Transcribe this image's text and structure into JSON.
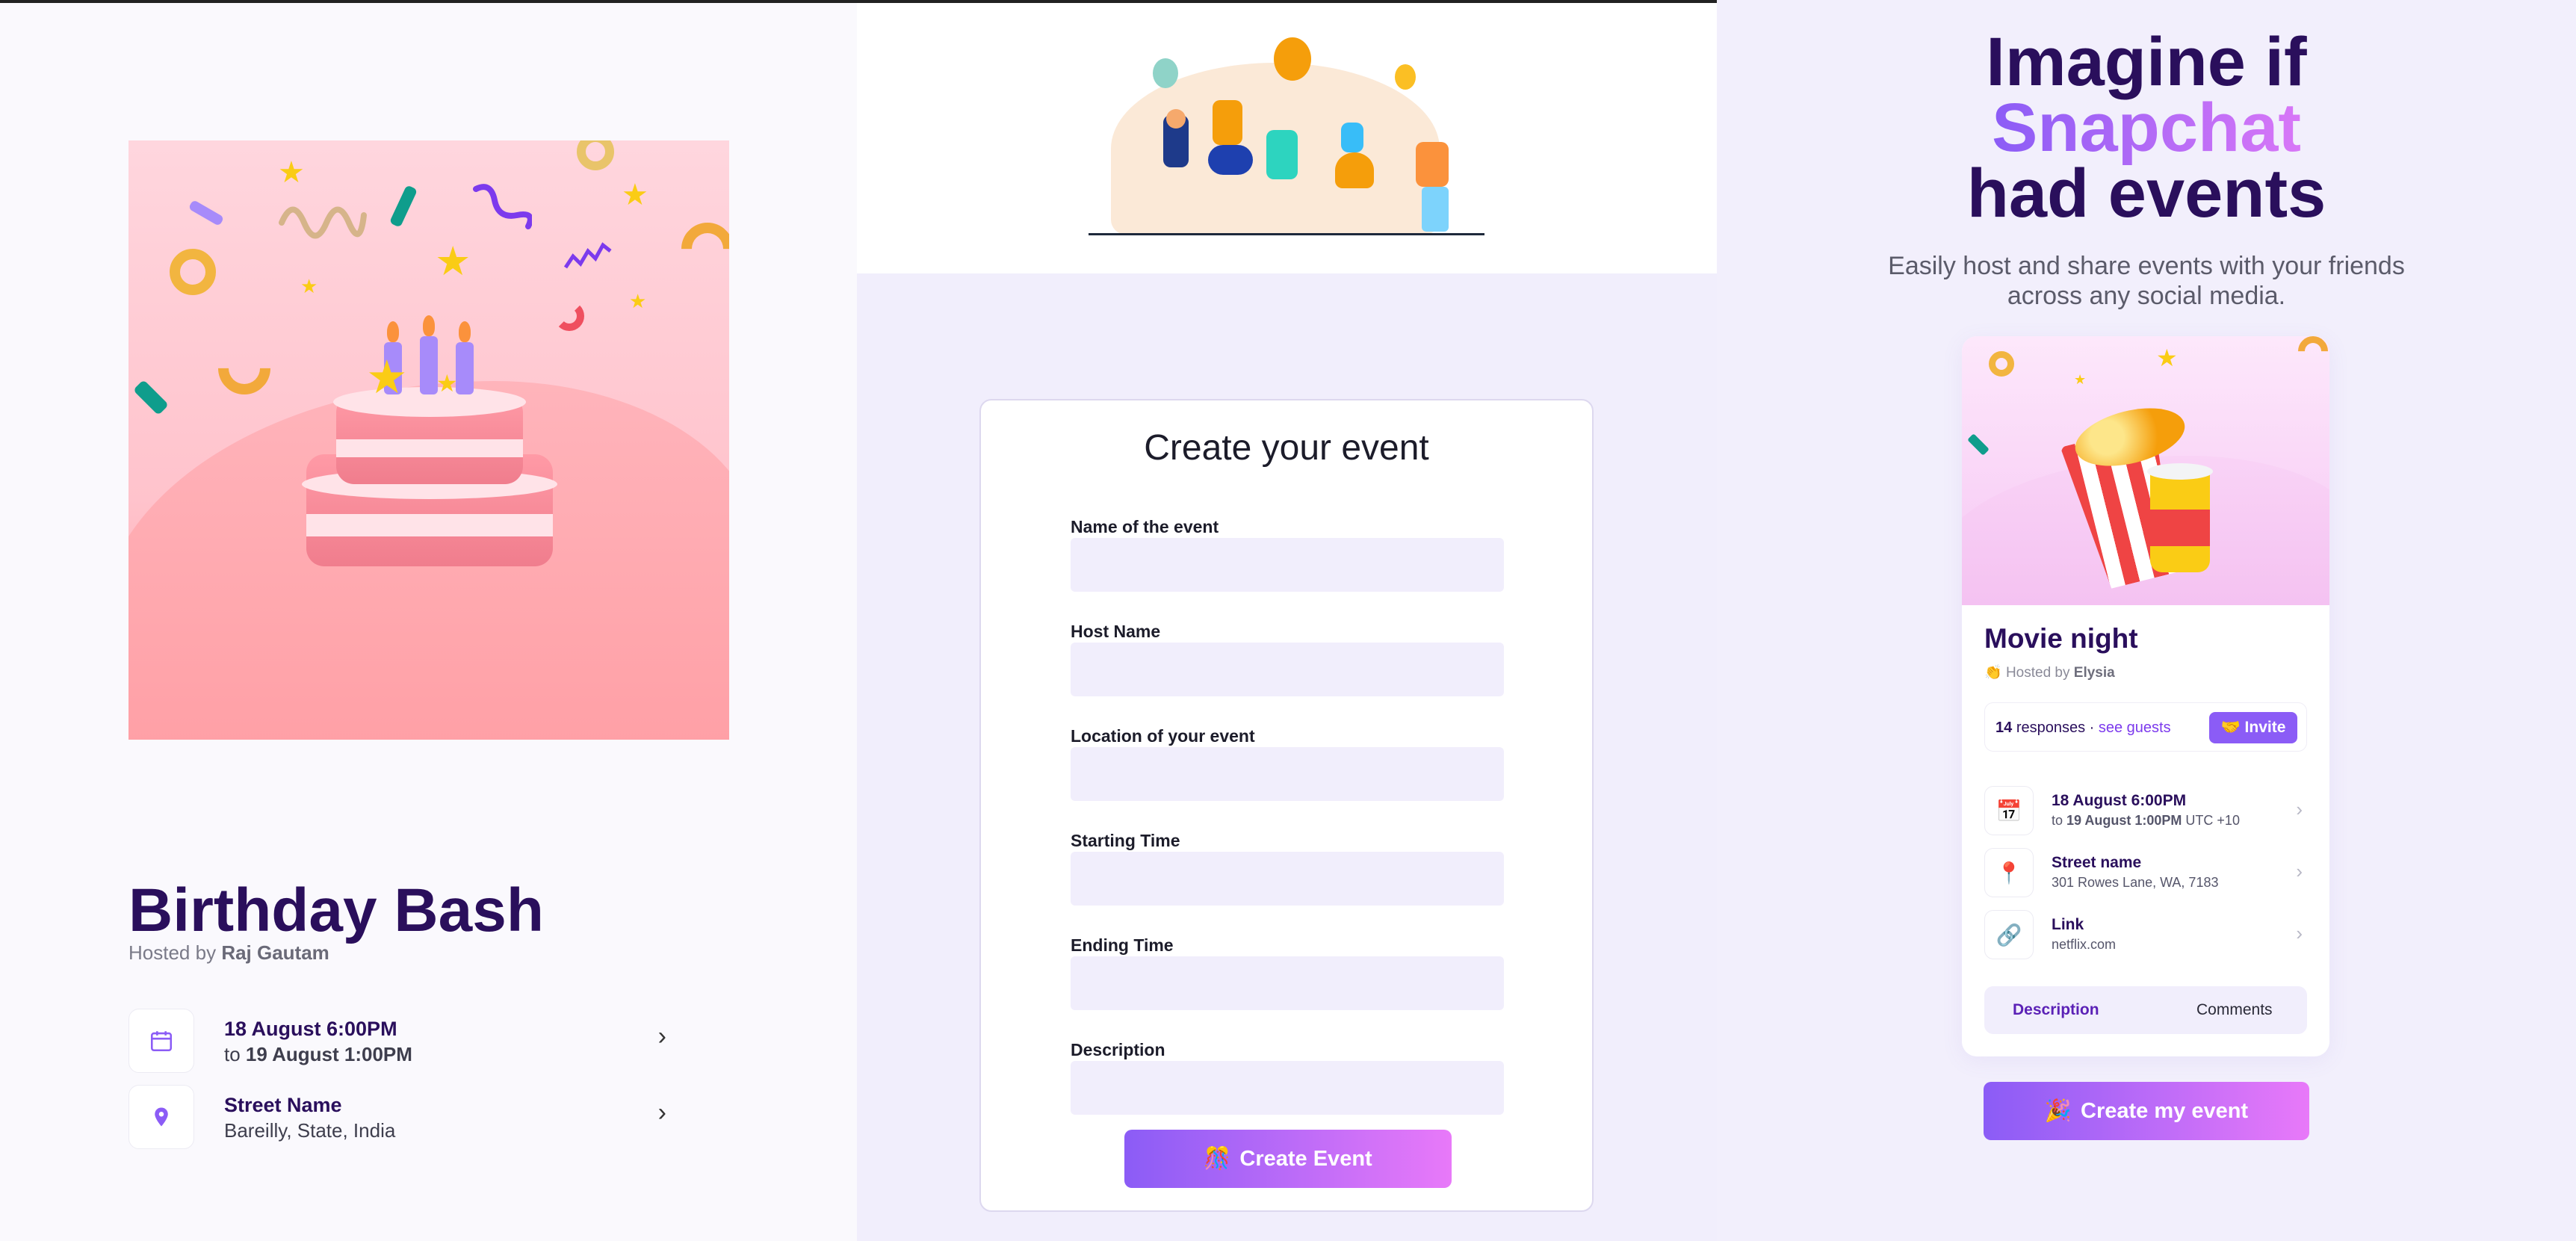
{
  "event_page": {
    "title": "Birthday Bash",
    "hosted_prefix": "Hosted by",
    "host": "Raj Gautam",
    "date_line1": "18 August 6:00PM",
    "date_to": "to",
    "date_line2": "19 August 1:00PM",
    "location_line1": "Street Name",
    "location_line2": "Bareilly, State, India",
    "chevron": "›"
  },
  "form": {
    "title": "Create your event",
    "fields": [
      {
        "label": "Name of the event"
      },
      {
        "label": "Host Name"
      },
      {
        "label": "Location of your event"
      },
      {
        "label": "Starting Time"
      },
      {
        "label": "Ending Time"
      },
      {
        "label": "Description"
      }
    ],
    "submit_icon": "🎊",
    "submit_label": "Create Event"
  },
  "landing": {
    "hero_line1": "Imagine if",
    "hero_line2": "Snapchat",
    "hero_line3": "had events",
    "subtitle": "Easily host and share events with your friends across any social media.",
    "card": {
      "title": "Movie night",
      "hosted_icon": "👏",
      "hosted_prefix": "Hosted by",
      "host": "Elysia",
      "responses_count": "14",
      "responses_label": "responses ·",
      "see_guests": "see guests",
      "invite_label": "🤝 Invite",
      "rows": [
        {
          "icon": "📅",
          "line1": "18 August 6:00PM",
          "line2_prefix": "to",
          "line2_bold": "19 August 1:00PM",
          "line2_suffix": "UTC +10"
        },
        {
          "icon": "📍",
          "line1": "Street name",
          "line2": "301 Rowes Lane, WA, 7183"
        },
        {
          "icon": "🔗",
          "line1": "Link",
          "line2": "netflix.com"
        }
      ],
      "tab_active": "Description",
      "tab_other": "Comments"
    },
    "cta_icon": "🎉",
    "cta_label": "Create my event"
  },
  "colors": {
    "brand_purple": "#8b5cf6",
    "brand_pink": "#e879f9",
    "title_navy": "#2a0f5c"
  }
}
